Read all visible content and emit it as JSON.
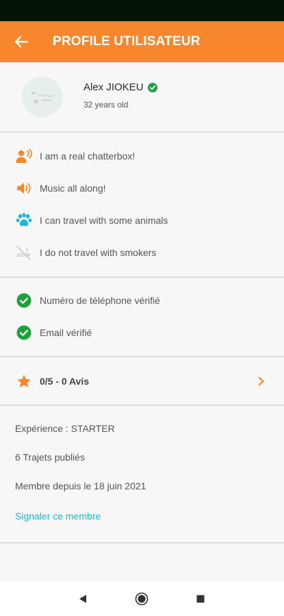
{
  "app_bar": {
    "title": "PROFILE UTILISATEUR",
    "back_icon": "arrow-left-icon"
  },
  "profile": {
    "name": "Alex JIOKEU",
    "age": "32 years old",
    "verified_icon": "verified-check-icon"
  },
  "preferences": [
    {
      "icon": "chatter-icon",
      "label": "I am a real chatterbox!"
    },
    {
      "icon": "music-icon",
      "label": "Music all along!"
    },
    {
      "icon": "paw-icon",
      "label": "I can travel with some animals"
    },
    {
      "icon": "no-smoking-icon",
      "label": "I do not travel with smokers"
    }
  ],
  "verifications": [
    {
      "icon": "check-circle-icon",
      "label": "Numéro de téléphone vérifié"
    },
    {
      "icon": "check-circle-icon",
      "label": "Email vérifié"
    }
  ],
  "rating": {
    "label": "0/5 - 0 Avis",
    "icon": "star-icon",
    "chevron_icon": "chevron-right-icon"
  },
  "stats": {
    "experience": "Expérience : STARTER",
    "trips": "6 Trajets publiés",
    "member_since": "Membre depuis le 18 juin 2021"
  },
  "report_link": "Signaler ce membre",
  "colors": {
    "accent": "#f7862c",
    "verified_green": "#1fa03a",
    "link": "#1fb7d6",
    "paw": "#1fb7d6"
  },
  "nav": {
    "back": "nav-back-icon",
    "home": "nav-home-icon",
    "recents": "nav-recents-icon"
  }
}
